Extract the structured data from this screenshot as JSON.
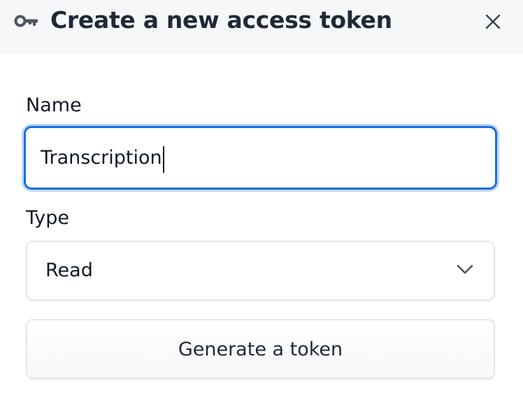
{
  "dialog": {
    "title": "Create a new access token",
    "title_icon": "key-icon",
    "close_icon": "close-icon"
  },
  "form": {
    "name_label": "Name",
    "name_value": "Transcription",
    "type_label": "Type",
    "type_selected": "Read",
    "type_dropdown_icon": "chevron-down-icon",
    "submit_label": "Generate a token"
  },
  "colors": {
    "focus_border": "#1a6fdc",
    "focus_ring": "#bfd7f7",
    "header_bg": "#f6f7f9",
    "text": "#1f2937"
  }
}
